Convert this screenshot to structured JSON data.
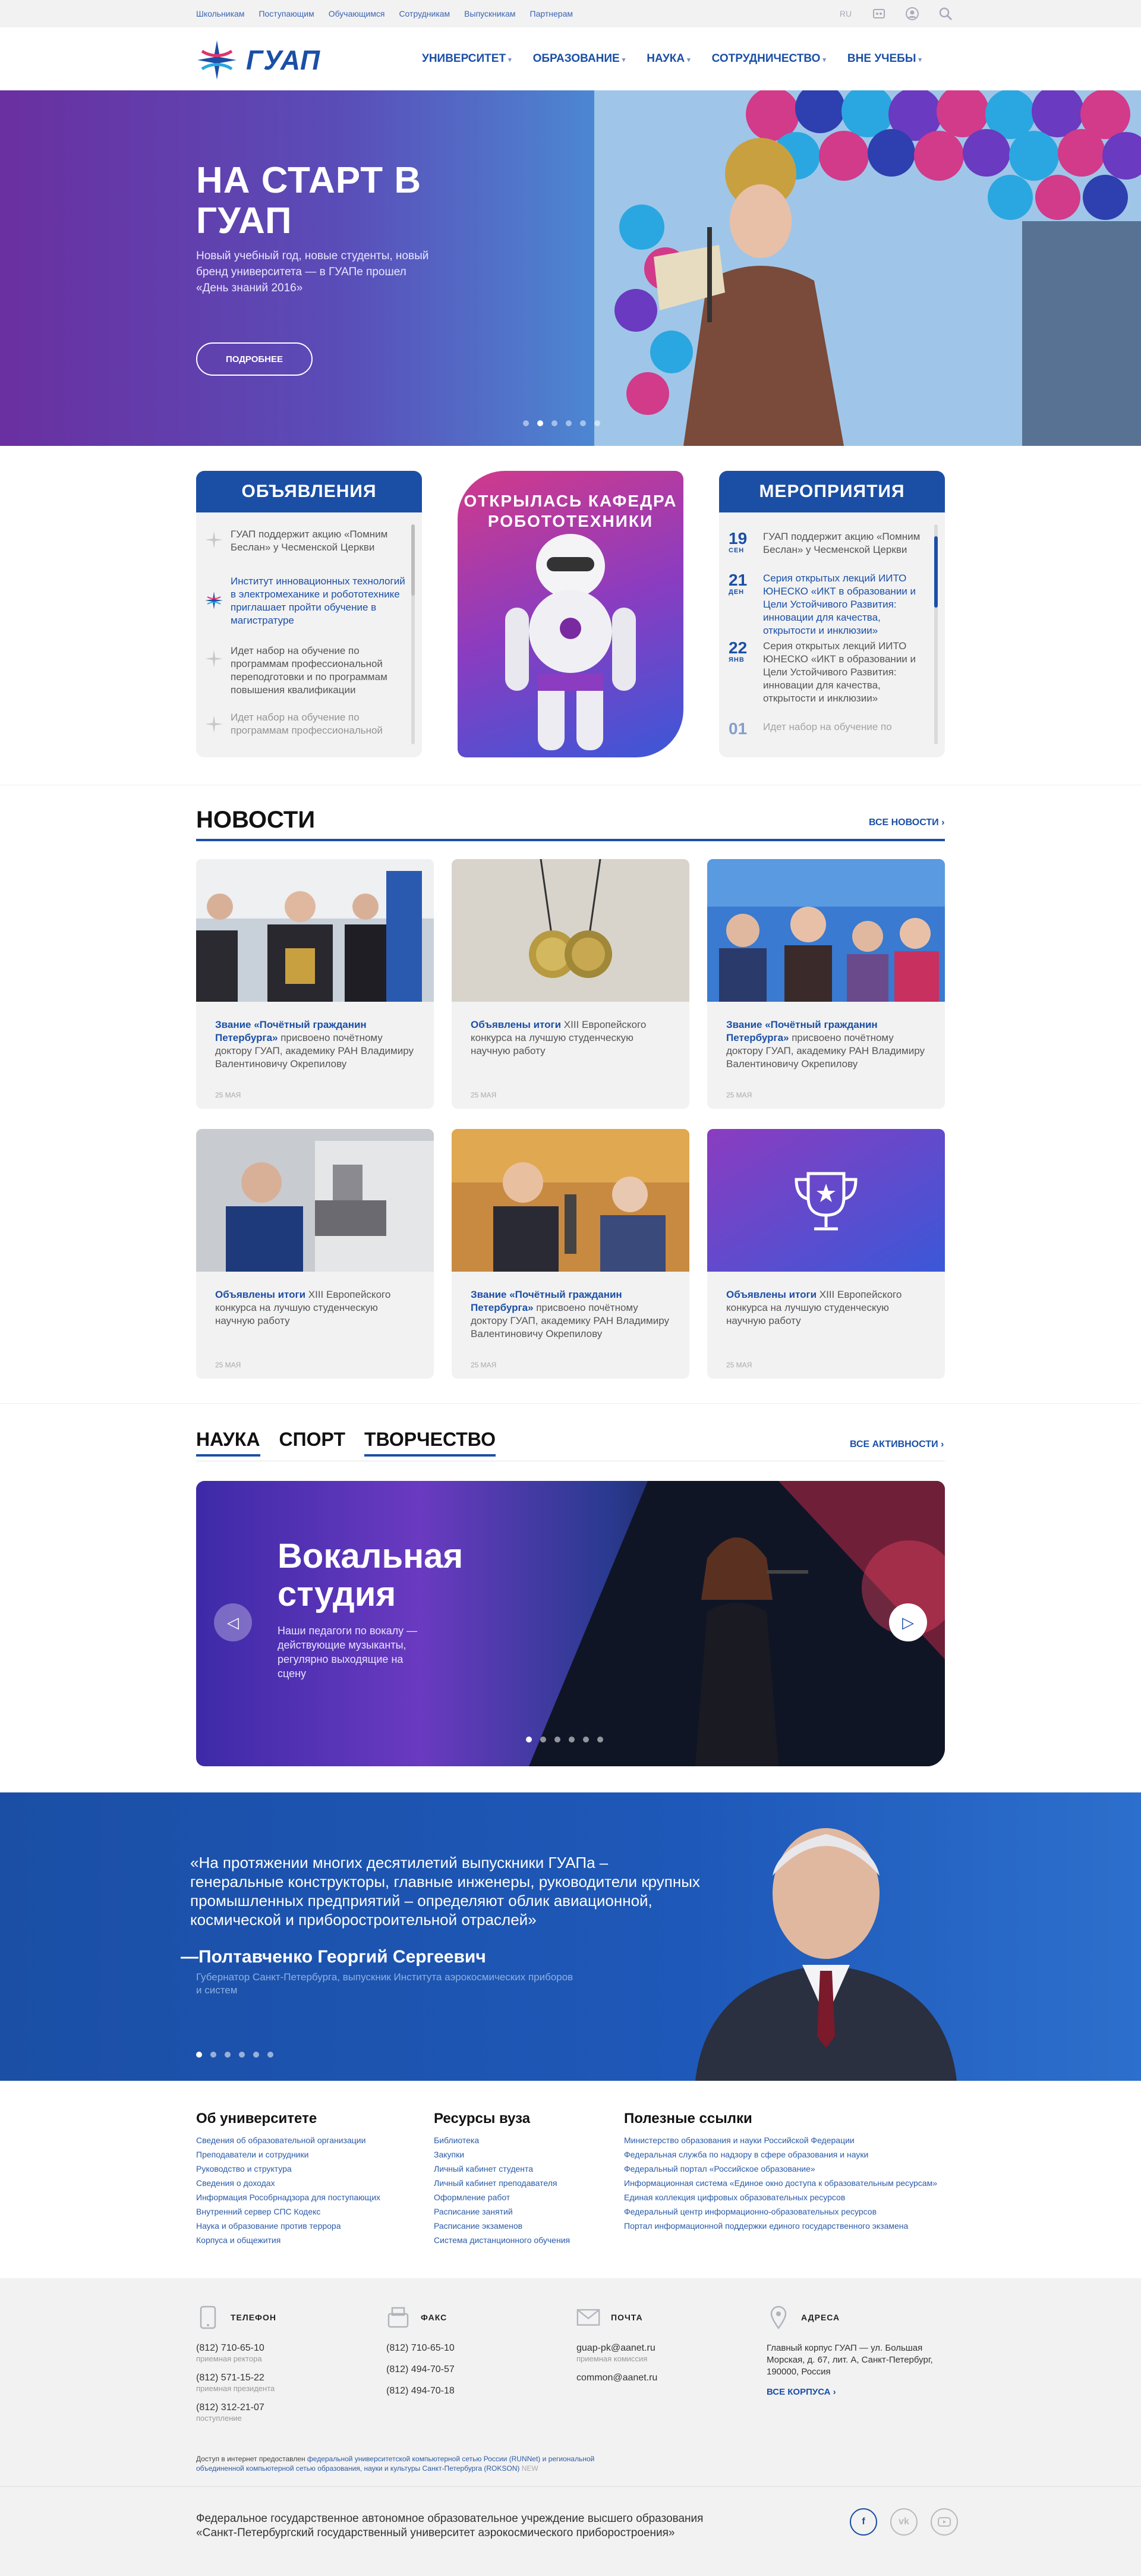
{
  "topbar": {
    "links": [
      "Школьникам",
      "Поступающим",
      "Обучающимся",
      "Сотрудникам",
      "Выпускникам",
      "Партнерам"
    ],
    "lang": "RU"
  },
  "header": {
    "logo_text": "ГУАП",
    "nav": [
      "УНИВЕРСИТЕТ",
      "ОБРАЗОВАНИЕ",
      "НАУКА",
      "СОТРУДНИЧЕСТВО",
      "ВНЕ УЧЕБЫ"
    ]
  },
  "hero": {
    "title": "НА СТАРТ В ГУАП",
    "text": "Новый учебный год, новые студенты, новый бренд университета — в ГУАПе прошел «День знаний 2016»",
    "button": "ПОДРОБНЕЕ"
  },
  "announcements": {
    "title": "ОБЪЯВЛЕНИЯ",
    "items": [
      "ГУАП поддержит акцию «Помним Беслан» у Чесменской Церкви",
      "Институт инновационных технологий в электромеханике и робототехнике приглашает пройти обучение в магистратуре",
      "Идет набор на обучение по программам профессиональной переподготовки и по программам повышения квалификации",
      "Идет набор на обучение по программам профессиональной"
    ]
  },
  "promo": {
    "title": "ОТКРЫЛАСЬ КАФЕДРА РОБОТОТЕХНИКИ"
  },
  "events": {
    "title": "МЕРОПРИЯТИЯ",
    "items": [
      {
        "day": "19",
        "month": "СЕН",
        "text": "ГУАП поддержит акцию «Помним Беслан» у Чесменской Церкви"
      },
      {
        "day": "21",
        "month": "ДЕН",
        "text": "Серия открытых лекций ИИТО ЮНЕСКО «ИКТ в образовании и Цели Устойчивого Развития: инновации для качества, открытости и инклюзии»"
      },
      {
        "day": "22",
        "month": "ЯНВ",
        "text": "Серия открытых лекций ИИТО ЮНЕСКО «ИКТ в образовании и Цели Устойчивого Развития: инновации для качества, открытости и инклюзии»"
      },
      {
        "day": "01",
        "month": "",
        "text": "Идет набор на обучение по"
      }
    ]
  },
  "news": {
    "title": "НОВОСТИ",
    "all": "ВСЕ НОВОСТИ ›",
    "cards": [
      {
        "bold": "Звание «Почётный гражданин Петербурга»",
        "text": " присвоено почётному доктору ГУАП, академику РАН Владимиру Валентиновичу Окрепилову",
        "date": "25 МАЯ"
      },
      {
        "bold": "Объявлены итоги",
        "text": " XIII Европейского конкурса на лучшую студенческую научную работу",
        "date": "25 МАЯ"
      },
      {
        "bold": "Звание «Почётный гражданин Петербурга»",
        "text": " присвоено почётному доктору ГУАП, академику РАН Владимиру Валентиновичу Окрепилову",
        "date": "25 МАЯ"
      },
      {
        "bold": "Объявлены итоги",
        "text": " XIII Европейского конкурса на лучшую студенческую научную работу",
        "date": "25 МАЯ"
      },
      {
        "bold": "Звание «Почётный гражданин Петербурга»",
        "text": " присвоено почётному доктору ГУАП, академику РАН Владимиру Валентиновичу Окрепилову",
        "date": "25 МАЯ"
      },
      {
        "bold": "Объявлены итоги",
        "text": " XIII Европейского конкурса на лучшую студенческую научную работу",
        "date": "25 МАЯ"
      }
    ]
  },
  "activities": {
    "tabs": [
      "НАУКА",
      "СПОРТ",
      "ТВОРЧЕСТВО"
    ],
    "all": "ВСЕ АКТИВНОСТИ ›",
    "slide_title": "Вокальная студия",
    "slide_text": "Наши педагоги по вокалу — действующие музыканты, регулярно выходящие на сцену"
  },
  "quote": {
    "text": "«На протяжении многих десятилетий выпускники ГУАПа – генеральные конструкторы, главные инженеры, руководители крупных промышленных предприятий – определяют облик авиационной, космической и приборостроительной отраслей»",
    "author": "—Полтавченко Георгий Сергеевич",
    "role": "Губернатор Санкт-Петербурга, выпускник Института аэрокосмических приборов и систем"
  },
  "links": {
    "col1": {
      "title": "Об университете",
      "items": [
        "Сведения об образовательной организации",
        "Преподаватели и сотрудники",
        "Руководство и структура",
        "Сведения о доходах",
        "Информация Рособрнадзора для поступающих",
        "Внутренний сервер СПС Кодекс",
        "Наука и образование против террора",
        "Корпуса и общежития"
      ]
    },
    "col2": {
      "title": "Ресурсы вуза",
      "items": [
        "Библиотека",
        "Закупки",
        "Личный кабинет студента",
        "Личный кабинет преподавателя",
        "Оформление работ",
        "Расписание занятий",
        "Расписание экзаменов",
        "Система дистанционного обучения"
      ]
    },
    "col3": {
      "title": "Полезные ссылки",
      "items": [
        "Министерство образования и науки Российской Федерации",
        "Федеральная служба по надзору в сфере образования и науки",
        "Федеральный портал «Российское образование»",
        "Информационная система «Единое окно доступа к образовательным ресурсам»",
        "Единая коллекция цифровых образовательных ресурсов",
        "Федеральный центр информационно-образовательных ресурсов",
        "Портал информационной поддержки единого государственного экзамена"
      ]
    }
  },
  "contacts": {
    "phone": {
      "label": "ТЕЛЕФОН",
      "rows": [
        {
          "v": "(812) 710-65-10",
          "s": "приемная ректора"
        },
        {
          "v": "(812) 571-15-22",
          "s": "приемная президента"
        },
        {
          "v": "(812) 312-21-07",
          "s": "поступление"
        }
      ]
    },
    "fax": {
      "label": "ФАКС",
      "rows": [
        {
          "v": "(812) 710-65-10",
          "s": ""
        },
        {
          "v": "(812) 494-70-57",
          "s": ""
        },
        {
          "v": "(812) 494-70-18",
          "s": ""
        }
      ]
    },
    "mail": {
      "label": "ПОЧТА",
      "rows": [
        {
          "v": "guap-pk@aanet.ru",
          "s": "приемная комиссия"
        },
        {
          "v": "common@aanet.ru",
          "s": ""
        }
      ]
    },
    "address": {
      "label": "АДРЕСА",
      "text": "Главный корпус ГУАП — ул. Большая Морская, д. 67, лит. А, Санкт-Петербург, 190000, Россия",
      "link": "ВСЕ КОРПУСА ›"
    },
    "access_prefix": "Доступ в интернет предоставлен ",
    "access_link": "федеральной университетской компьютерной сетью России (RUNNet) и региональной объединенной компьютерной сетью образования, науки и культуры Санкт-Петербурга (ROKSON)",
    "access_suffix": " NEW"
  },
  "footer": {
    "text": "Федеральное государственное автономное образовательное учреждение высшего образования «Санкт-Петербургский государственный университет аэрокосмического приборостроения»",
    "social": [
      "f",
      "vk",
      "yt"
    ]
  },
  "colors": {
    "brand": "#1b4fa6",
    "accent": "#c2185b"
  }
}
